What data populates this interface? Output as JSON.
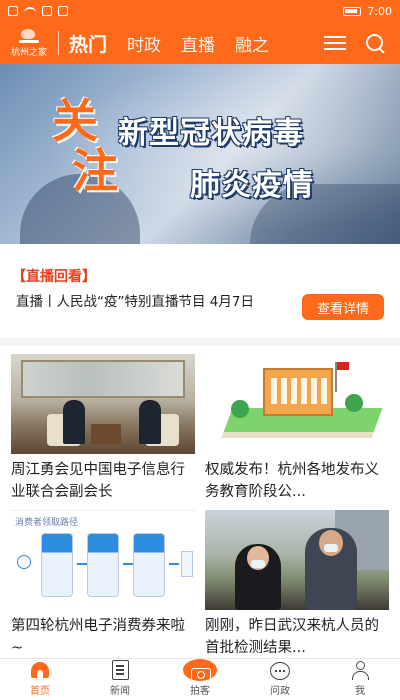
{
  "status_bar": {
    "left_icons": [
      "signal-icon",
      "wifi-icon",
      "notification-icon",
      "message-icon"
    ],
    "time": "7:00"
  },
  "nav": {
    "logo_text": "杭州之家",
    "tabs": [
      {
        "label": "热门",
        "active": true
      },
      {
        "label": "时政",
        "active": false
      },
      {
        "label": "直播",
        "active": false
      },
      {
        "label": "融之",
        "active": false
      }
    ],
    "icons": [
      "menu-icon",
      "search-icon"
    ]
  },
  "banner": {
    "big_char_1": "关",
    "big_char_2": "注",
    "line1": "新型冠状病毒",
    "line2": "肺炎疫情",
    "slides": 5,
    "active_slide": 1
  },
  "live": {
    "tag": "【直播回看】",
    "text": "直播丨人民战“疫”特别直播节目 4月7日",
    "button": "查看详情"
  },
  "feed": [
    {
      "title": "周江勇会见中国电子信息行业联合会副会长",
      "image": "meeting-photo"
    },
    {
      "title": "权威发布！杭州各地发布义务教育阶段公...",
      "image": "school-illustration"
    },
    {
      "title": "第四轮杭州电子消费券来啦~",
      "image": "flow-diagram",
      "image_header": "消费者领取路径"
    },
    {
      "title": "刚刚，昨日武汉来杭人员的首批检测结果...",
      "image": "people-photo"
    }
  ],
  "bottom_nav": [
    {
      "label": "首页",
      "icon": "home-icon",
      "active": true
    },
    {
      "label": "新闻",
      "icon": "news-icon",
      "active": false
    },
    {
      "label": "拍客",
      "icon": "camera-icon",
      "active": false
    },
    {
      "label": "问政",
      "icon": "ask-icon",
      "active": false
    },
    {
      "label": "我",
      "icon": "me-icon",
      "active": false
    }
  ],
  "colors": {
    "brand": "#ff6a1a",
    "accent_text": "#e5411f"
  }
}
